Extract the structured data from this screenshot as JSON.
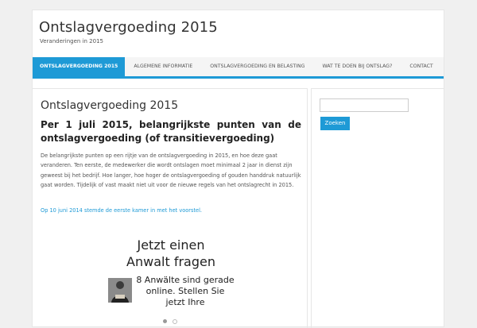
{
  "header": {
    "site_title": "Ontslagvergoeding 2015",
    "site_description": "Veranderingen in 2015"
  },
  "nav": {
    "items": [
      {
        "label": "ONTSLAGVERGOEDING 2015",
        "active": true
      },
      {
        "label": "ALGEMENE INFORMATIE",
        "active": false
      },
      {
        "label": "ONTSLAGVERGOEDING EN BELASTING",
        "active": false
      },
      {
        "label": "WAT TE DOEN BIJ ONTSLAG?",
        "active": false
      },
      {
        "label": "CONTACT",
        "active": false
      }
    ]
  },
  "article": {
    "title": "Ontslagvergoeding 2015",
    "subtitle": "Per 1 juli 2015, belangrijkste punten van de ontslagvergoeding (of transitievergoeding)",
    "body": "De belangrijkste punten op een rijtje van de ontslagvergoeding in 2015, en hoe deze gaat veranderen. Ten eerste, de medewerker die wordt ontslagen moet minimaal 2 jaar in dienst zijn geweest bij het bedrijf. Hoe langer, hoe hoger de ontslagvergoeding of gouden handdruk natuurlijk gaat worden. Tijdelijk of vast maakt niet uit voor de nieuwe regels van het ontslagrecht in 2015.",
    "link_text": "Op 10 juni 2014 stemde de eerste kamer in met het voorstel."
  },
  "ad": {
    "headline": "Jetzt einen Anwalt fragen",
    "text": "8 Anwälte sind gerade online. Stellen Sie jetzt Ihre",
    "carousel_active_index": 0,
    "carousel_count": 2
  },
  "sidebar": {
    "search_value": "",
    "search_button_label": "Zoeken"
  },
  "colors": {
    "accent": "#1e9ad6",
    "background": "#f0f0f0",
    "panel": "#ffffff"
  }
}
